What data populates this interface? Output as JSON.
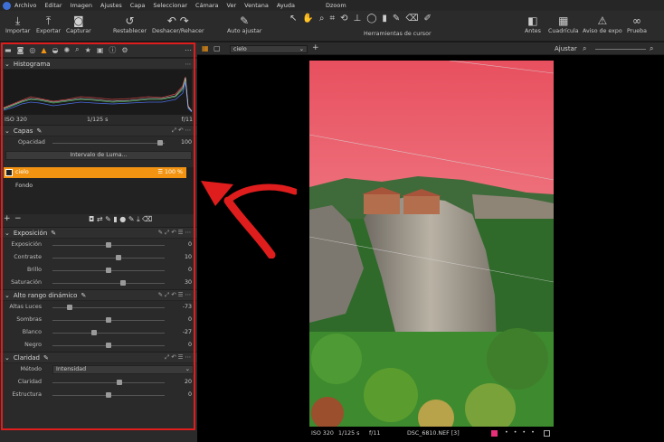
{
  "menu": [
    "Archivo",
    "Editar",
    "Imagen",
    "Ajustes",
    "Capa",
    "Seleccionar",
    "Cámara",
    "Ver",
    "Ventana",
    "Ayuda"
  ],
  "app_title": "Dzoom",
  "toolbar": {
    "import": "Importar",
    "export": "Exportar",
    "capture": "Capturar",
    "reset": "Restablecer",
    "undo_redo": "Deshacer/Rehacer",
    "auto": "Auto ajustar",
    "cursor_tools": "Herramientas de cursor",
    "before": "Antes",
    "grid": "Cuadrícula",
    "exposure_warning": "Aviso de expo",
    "proof": "Prueba"
  },
  "histogram": {
    "title": "Histograma",
    "iso": "ISO 320",
    "shutter": "1/125 s",
    "aperture": "f/11"
  },
  "layers": {
    "title": "Capas",
    "opacity_label": "Opacidad",
    "opacity_value": "100",
    "opacity": 0.96,
    "luma_button": "Intervalo de Luma...",
    "items": [
      {
        "name": "cielo",
        "pct": "100 %"
      },
      {
        "name": "Fondo"
      }
    ]
  },
  "exposure": {
    "title": "Exposición",
    "rows": [
      {
        "label": "Exposición",
        "value": "0",
        "pos": 0.5
      },
      {
        "label": "Contraste",
        "value": "10",
        "pos": 0.59
      },
      {
        "label": "Brillo",
        "value": "0",
        "pos": 0.5
      },
      {
        "label": "Saturación",
        "value": "30",
        "pos": 0.63
      }
    ]
  },
  "hdr": {
    "title": "Alto rango dinámico",
    "rows": [
      {
        "label": "Altas Luces",
        "value": "-73",
        "pos": 0.15
      },
      {
        "label": "Sombras",
        "value": "0",
        "pos": 0.5
      },
      {
        "label": "Blanco",
        "value": "-27",
        "pos": 0.37
      },
      {
        "label": "Negro",
        "value": "0",
        "pos": 0.5
      }
    ]
  },
  "clarity": {
    "title": "Claridad",
    "method_label": "Método",
    "method_value": "Intensidad",
    "rows": [
      {
        "label": "Claridad",
        "value": "20",
        "pos": 0.6
      },
      {
        "label": "Estructura",
        "value": "0",
        "pos": 0.5
      }
    ]
  },
  "viewer": {
    "layer_select": "cielo",
    "adjust_label": "Ajustar",
    "iso": "ISO 320",
    "shutter": "1/125 s",
    "aperture": "f/11",
    "filename": "DSC_6810.NEF [3]"
  },
  "colors": {
    "accent": "#f29412",
    "highlight": "#e01d1d"
  }
}
